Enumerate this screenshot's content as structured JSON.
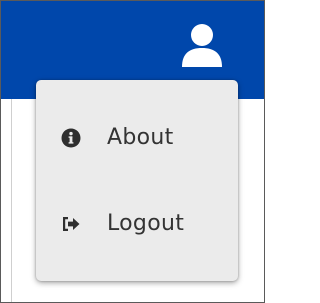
{
  "header": {
    "background_color": "#0047AB",
    "account_icon": "user-icon"
  },
  "menu": {
    "items": [
      {
        "label": "About",
        "icon": "info-circle-icon"
      },
      {
        "label": "Logout",
        "icon": "sign-out-icon"
      }
    ]
  }
}
